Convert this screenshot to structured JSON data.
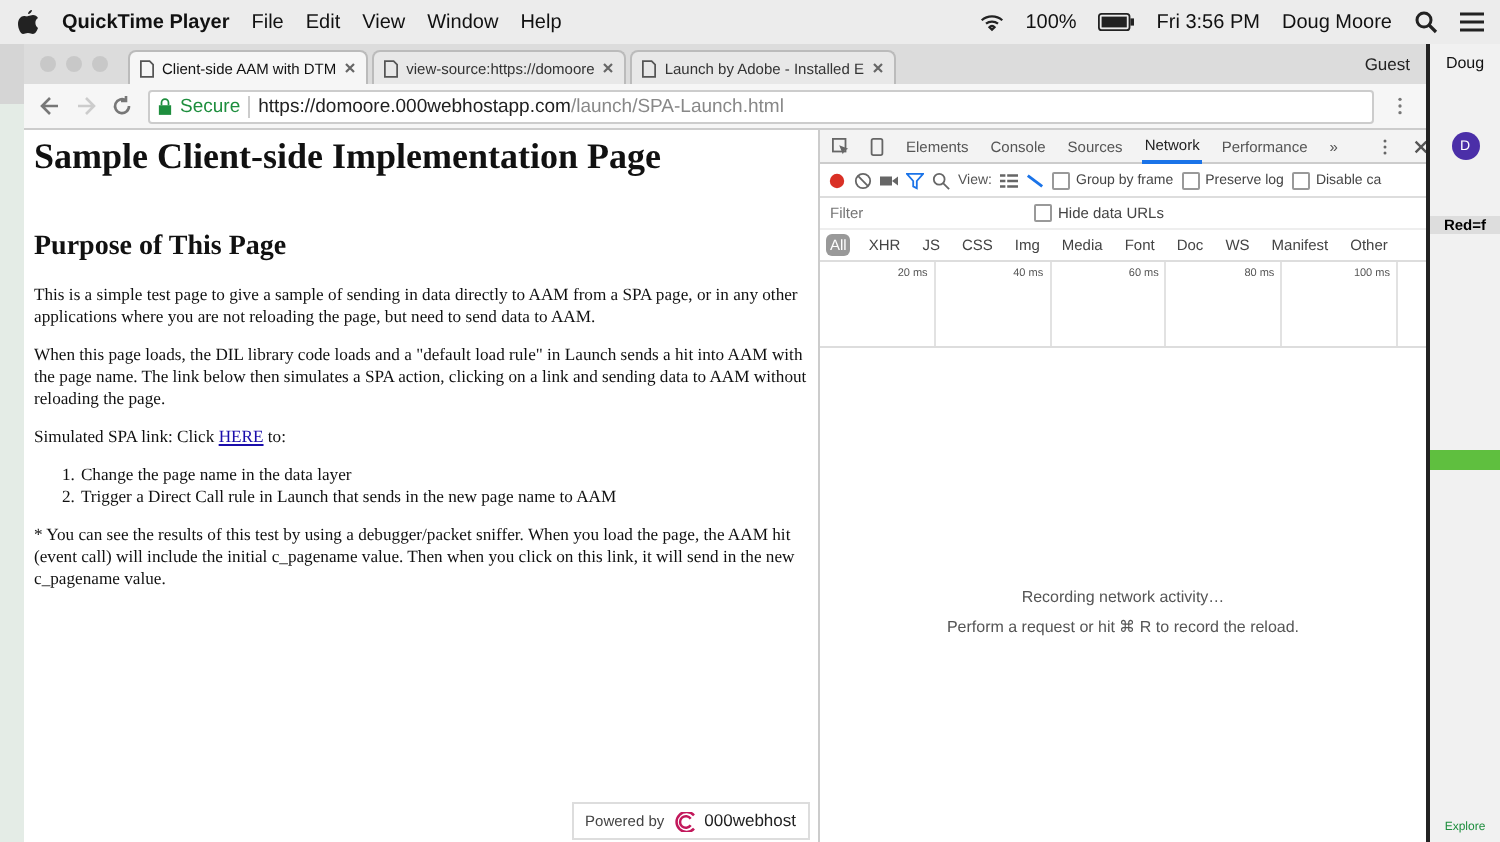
{
  "menubar": {
    "app": "QuickTime Player",
    "menus": [
      "File",
      "Edit",
      "View",
      "Window",
      "Help"
    ],
    "battery": "100%",
    "clock": "Fri 3:56 PM",
    "user": "Doug Moore"
  },
  "browser": {
    "tabs": [
      {
        "title": "Client-side AAM with DTM",
        "selected": true
      },
      {
        "title": "view-source:https://domoore",
        "selected": false
      },
      {
        "title": "Launch by Adobe - Installed E",
        "selected": false
      }
    ],
    "profile": "Guest",
    "secure_label": "Secure",
    "url_host": "https://domoore.000webhostapp.com",
    "url_path": "/launch/SPA-Launch.html"
  },
  "page": {
    "title": "Sample Client-side Implementation Page",
    "heading": "Purpose of This Page",
    "paragraphs": [
      "This is a simple test page to give a sample of sending in data directly to AAM from a SPA page, or in any other applications where you are not reloading the page, but need to send data to AAM.",
      "When this page loads, the DIL library code loads and a \"default load rule\" in Launch sends a hit into AAM with the page name. The link below then simulates a SPA action, clicking on a link and sending data to AAM without reloading the page."
    ],
    "link_line": {
      "before": "Simulated SPA link: Click",
      "link": "HERE",
      "after": "to:"
    },
    "steps": [
      {
        "number": "1.",
        "text": "Change the page name in the data layer"
      },
      {
        "number": "2.",
        "text": "Trigger a Direct Call rule in Launch that sends in the new page name to AAM"
      }
    ],
    "note": "* You can see the results of this test by using a debugger/packet sniffer. When you load the page, the AAM hit (event call) will include the initial c_pagename value. Then when you click on this link, it will send in the new c_pagename value.",
    "footer": {
      "prefix": "Powered by",
      "brand": "000webhost"
    }
  },
  "devtools": {
    "tabs": [
      {
        "label": "Elements",
        "selected": false
      },
      {
        "label": "Console",
        "selected": false
      },
      {
        "label": "Sources",
        "selected": false
      },
      {
        "label": "Network",
        "selected": true
      },
      {
        "label": "Performance",
        "selected": false
      }
    ],
    "more": "»",
    "view_label": "View:",
    "options": [
      {
        "label": "Group by frame",
        "checked": false
      },
      {
        "label": "Preserve log",
        "checked": false
      },
      {
        "label": "Disable ca",
        "checked": false
      }
    ],
    "filter": {
      "placeholder": "Filter"
    },
    "hide_data_urls": {
      "label": "Hide data URLs",
      "checked": false
    },
    "types": [
      {
        "label": "All",
        "selected": true
      },
      {
        "label": "XHR",
        "selected": false
      },
      {
        "label": "JS",
        "selected": false
      },
      {
        "label": "CSS",
        "selected": false
      },
      {
        "label": "Img",
        "selected": false
      },
      {
        "label": "Media",
        "selected": false
      },
      {
        "label": "Font",
        "selected": false
      },
      {
        "label": "Doc",
        "selected": false
      },
      {
        "label": "WS",
        "selected": false
      },
      {
        "label": "Manifest",
        "selected": false
      },
      {
        "label": "Other",
        "selected": false
      }
    ],
    "ticks": [
      "20 ms",
      "40 ms",
      "60 ms",
      "80 ms",
      "100 ms"
    ],
    "status": "Recording network activity…",
    "hint": "Perform a request or hit ⌘ R to record the reload."
  },
  "background_window": {
    "title": "Doug",
    "avatar": "D",
    "cell": "Red=f",
    "link": "Explore"
  }
}
